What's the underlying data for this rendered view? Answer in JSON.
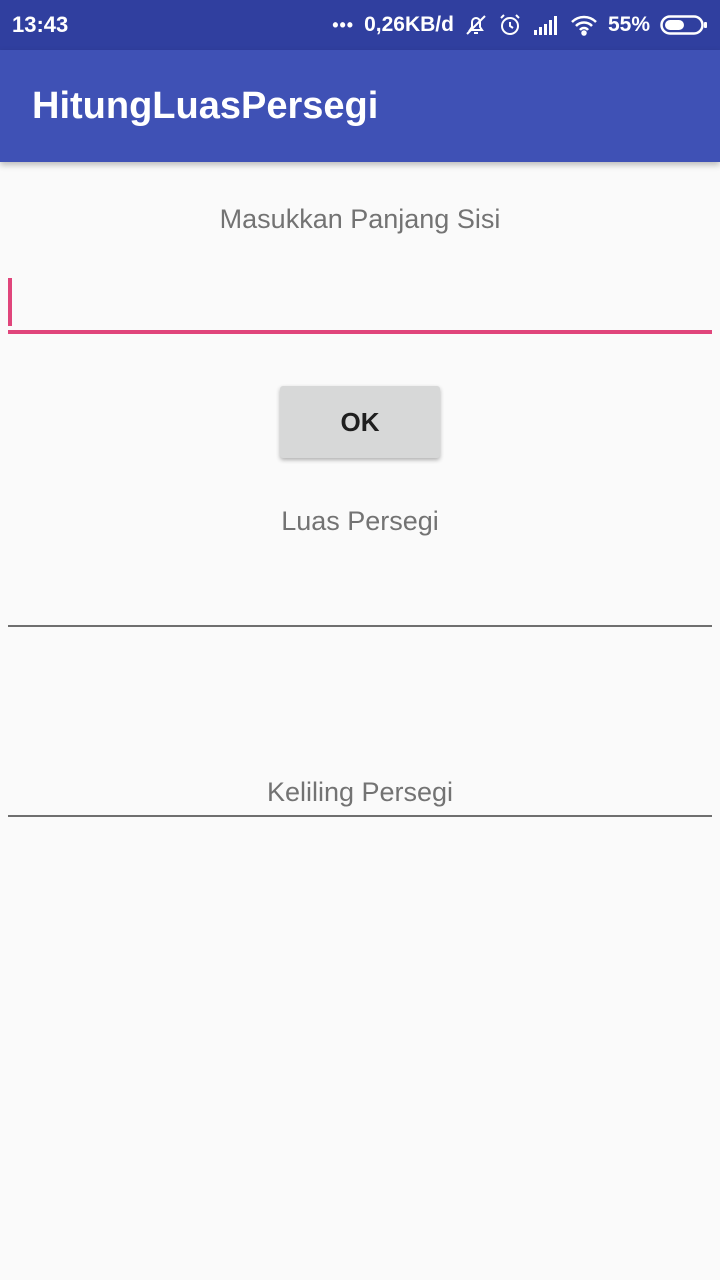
{
  "status_bar": {
    "time": "13:43",
    "more_dots": "•••",
    "network_speed": "0,26KB/d",
    "battery_percent": "55%",
    "icons": [
      "notifications-off-icon",
      "alarm-icon",
      "cell-signal-icon",
      "wifi-icon",
      "battery-icon"
    ],
    "battery_level": 0.55
  },
  "app_bar": {
    "title": "HitungLuasPersegi",
    "color": "#3f51b5",
    "status_color": "#303f9f"
  },
  "form": {
    "side_label": "Masukkan Panjang Sisi",
    "side_value": "",
    "ok_label": "OK",
    "area_label": "Luas Persegi",
    "area_value": "",
    "perimeter_label": "Keliling Persegi",
    "accent_color": "#e0457b"
  }
}
